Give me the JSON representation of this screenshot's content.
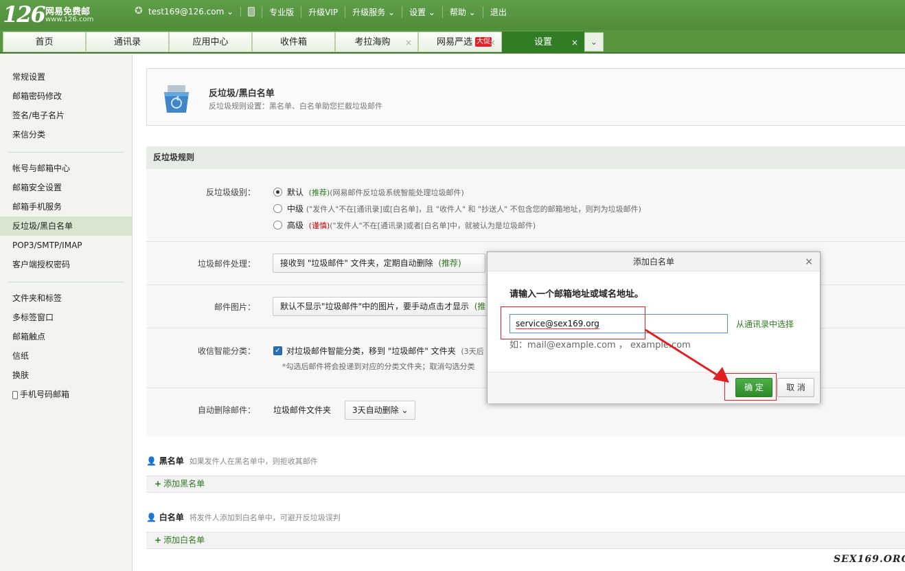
{
  "brand": {
    "logo_number": "126",
    "name": "网易免费邮",
    "domain": "www.126.com"
  },
  "topnav": {
    "user": "test169@126.com",
    "items": [
      "专业版",
      "升级VIP",
      "升级服务",
      "设置",
      "帮助",
      "退出"
    ]
  },
  "tabs": [
    {
      "label": "首页"
    },
    {
      "label": "通讯录"
    },
    {
      "label": "应用中心"
    },
    {
      "label": "收件箱"
    },
    {
      "label": "考拉海购",
      "close": "×"
    },
    {
      "label": "网易严选",
      "badge": "大促",
      "close": "×"
    },
    {
      "label": "设置",
      "close": "×"
    }
  ],
  "sidebar": {
    "items": [
      "常规设置",
      "邮箱密码修改",
      "签名/电子名片",
      "来信分类",
      "帐号与邮箱中心",
      "邮箱安全设置",
      "邮箱手机服务",
      "反垃圾/黑白名单",
      "POP3/SMTP/IMAP",
      "客户端授权密码",
      "文件夹和标签",
      "多标签窗口",
      "邮箱触点",
      "信纸",
      "换肤",
      "手机号码邮箱"
    ]
  },
  "header": {
    "title": "反垃圾/黑白名单",
    "desc": "反垃圾规则设置：黑名单、白名单助您拦截垃圾邮件"
  },
  "rules": {
    "section_title": "反垃圾规则",
    "level_label": "反垃圾级别：",
    "level_options": [
      {
        "name": "默认",
        "tag": "(推荐)",
        "note": "(网易邮件反垃圾系统智能处理垃圾邮件)"
      },
      {
        "name": "中级",
        "tag": "",
        "note": "(\"发件人\"不在[通讯录]或[白名单]，且 \"收件人\" 和 \"抄送人\" 不包含您的邮箱地址，则判为垃圾邮件)"
      },
      {
        "name": "高级",
        "tag": "(谨慎)",
        "note": "(\"发件人\"不在[通讯录]或者[白名单]中，就被认为是垃圾邮件)"
      }
    ],
    "handle_label": "垃圾邮件处理：",
    "handle_value": "接收到 \"垃圾邮件\" 文件夹，定期自动删除",
    "handle_tag": "(推荐)",
    "image_label": "邮件图片：",
    "image_value": "默认不显示\"垃圾邮件\"中的图片，要手动点击才显示",
    "image_tag": "(推",
    "smart_label": "收信智能分类：",
    "smart_value": "对垃圾邮件智能分类，移到 \"垃圾邮件\" 文件夹",
    "smart_days": "(3天后",
    "smart_note": "*勾选后邮件将会投递到对应的分类文件夹；取消勾选分类",
    "autodel_label": "自动删除邮件：",
    "autodel_folder": "垃圾邮件文件夹",
    "autodel_value": "3天自动删除"
  },
  "blacklist": {
    "title": "黑名单",
    "desc": "如果发件人在黑名单中，则拒收其邮件",
    "add": "添加黑名单"
  },
  "whitelist": {
    "title": "白名单",
    "desc": "将发件人添加到白名单中，可避开反垃圾误判",
    "add": "添加白名单"
  },
  "modal": {
    "title": "添加白名单",
    "prompt": "请输入一个邮箱地址或域名地址。",
    "input_value": "service@sex169.org",
    "pick_link": "从通讯录中选择",
    "example": "如：mail@example.com ， example.com",
    "ok": "确 定",
    "cancel": "取 消",
    "close": "×"
  },
  "watermark": "SEX169.ORG",
  "colors": {
    "brand_green": "#4f8d3b",
    "active_tab": "#317c25",
    "ok_button": "#3a9a36",
    "highlight": "#e02020"
  }
}
